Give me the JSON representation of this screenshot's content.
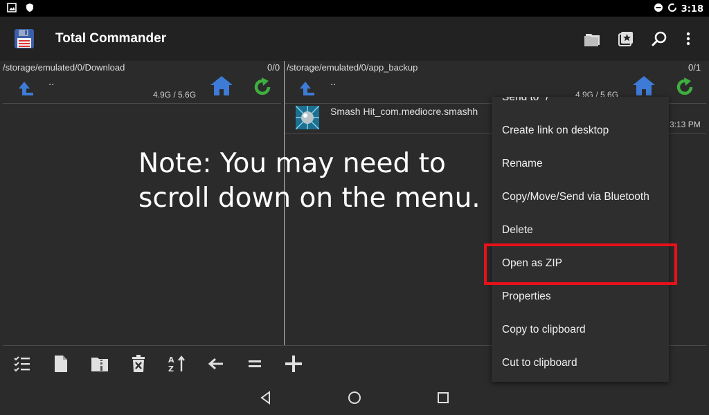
{
  "status_bar": {
    "time": "3:18"
  },
  "app": {
    "title": "Total Commander"
  },
  "left_panel": {
    "path": "/storage/emulated/0/Download",
    "count": "0/0",
    "updir": "..",
    "space": "4.9G / 5.6G"
  },
  "right_panel": {
    "path": "/storage/emulated/0/app_backup",
    "count": "0/1",
    "updir": "..",
    "space": "4.9G / 5.6G",
    "files": [
      {
        "name": "Smash Hit_com.mediocre.smashh",
        "time": "3:13 PM"
      }
    ]
  },
  "note": {
    "line1": "Note: You may need to",
    "line2": "scroll down on the menu."
  },
  "context_menu": {
    "items": [
      "Send to \"/\"",
      "Create link on desktop",
      "Rename",
      "Copy/Move/Send via Bluetooth",
      "Delete",
      "Open as ZIP",
      "Properties",
      "Copy to clipboard",
      "Cut to clipboard"
    ],
    "highlighted": "Open as ZIP",
    "highlight_color": "#e8111a"
  },
  "colors": {
    "accent_blue": "#3e7bd6",
    "reload_green": "#3fae3f",
    "background": "#2b2b2b"
  }
}
